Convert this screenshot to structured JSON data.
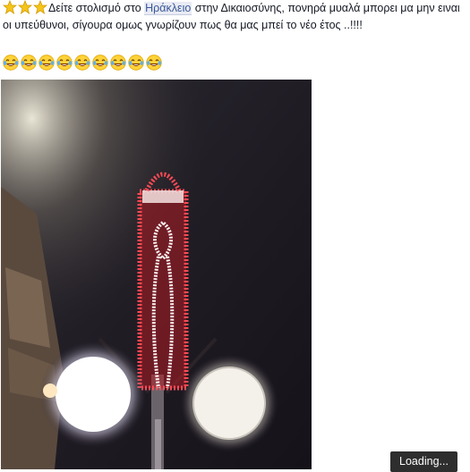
{
  "post": {
    "text_before_mention": "Δείτε στολισμό στο ",
    "mention": "Ηράκλειο",
    "text_after_mention": " στην Δικαιοσύνης, πονηρά μυαλά μπορει μα μην ειναι οι υπεύθυνοι, σίγουρα ομως γνωρίζουν πως θα μας μπεί το νέο έτος ..!!!!",
    "star_icon": "star-icon",
    "star_count": 3,
    "emoji_icon": "laughing-tears-emoji",
    "emoji_count": 9
  },
  "photo": {
    "subject": "lit-street-decoration-photo"
  },
  "status": {
    "loading_label": "Loading..."
  },
  "colors": {
    "mention_bg": "#e9ebf4",
    "mention_text": "#3b5998",
    "loading_bg": "#2e2e2e"
  }
}
